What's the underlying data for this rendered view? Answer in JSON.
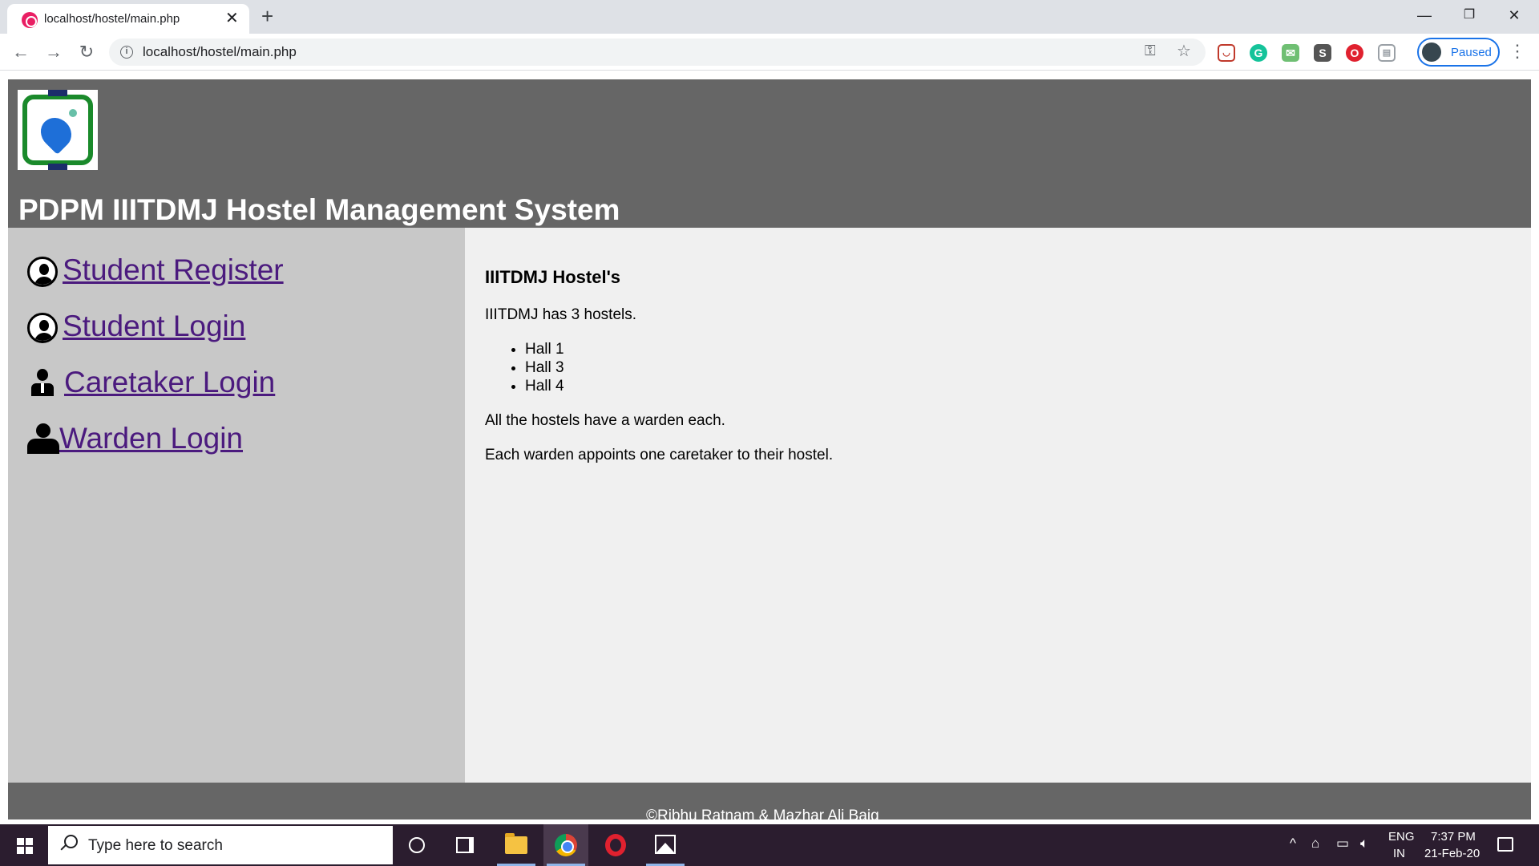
{
  "browser": {
    "tab_title": "localhost/hostel/main.php",
    "tab_close": "✕",
    "new_tab": "+",
    "url": "localhost/hostel/main.php",
    "profile_label": "Paused",
    "window_controls": {
      "minimize": "—",
      "restore": "❐",
      "close": "✕"
    }
  },
  "header": {
    "title": "PDPM IIITDMJ Hostel Management System"
  },
  "sidebar": {
    "items": [
      {
        "label": " Student Register",
        "icon": "user-circle-icon"
      },
      {
        "label": " Student Login",
        "icon": "user-circle-icon"
      },
      {
        "label": " Caretaker Login",
        "icon": "user-tie-icon"
      },
      {
        "label": "Warden Login",
        "icon": "user-icon"
      }
    ]
  },
  "main": {
    "heading": "IIITDMJ Hostel's",
    "intro": "IIITDMJ has 3 hostels.",
    "halls": [
      "Hall 1",
      "Hall 3",
      "Hall 4"
    ],
    "para1": "All the hostels have a warden each.",
    "para2": "Each warden appoints one caretaker to their hostel."
  },
  "footer": {
    "text": "©Ribhu Ratnam & Mazhar Ali Baig"
  },
  "taskbar": {
    "search_placeholder": "Type here to search",
    "language_top": "ENG",
    "language_bottom": "IN",
    "time": "7:37 PM",
    "date": "21-Feb-20"
  },
  "colors": {
    "header_bg": "#666666",
    "sidebar_bg": "#c8c8c8",
    "main_bg": "#f0f0f0",
    "link": "#4b1a7e",
    "taskbar_bg": "#2b1d2f"
  }
}
